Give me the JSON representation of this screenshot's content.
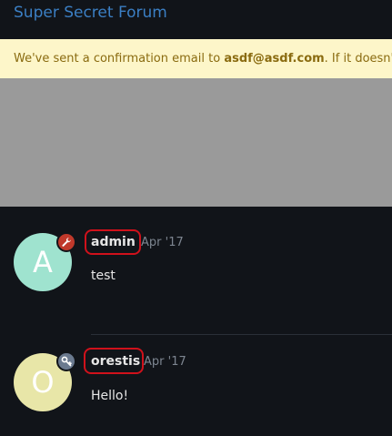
{
  "header": {
    "site_title": "Super Secret Forum"
  },
  "notice": {
    "prefix": "We've sent a confirmation email to ",
    "email": "asdf@asdf.com",
    "suffix": ". If it doesn't arriv"
  },
  "posts": [
    {
      "avatar_letter": "A",
      "avatar_color": "#9fe3cf",
      "badge_icon": "wrench-icon",
      "badge_color": "#c0392b",
      "username": "admin",
      "date": "Apr '17",
      "body": "test"
    },
    {
      "avatar_letter": "O",
      "avatar_color": "#e8e6a8",
      "badge_icon": "key-icon",
      "badge_color": "#6b7a8f",
      "username": "orestis",
      "date": "Apr '17",
      "body": "Hello!"
    }
  ],
  "colors": {
    "background": "#111419",
    "title": "#3b7fc4",
    "notice_bg": "#fdf6c9",
    "highlight_ring": "#d0111b"
  }
}
